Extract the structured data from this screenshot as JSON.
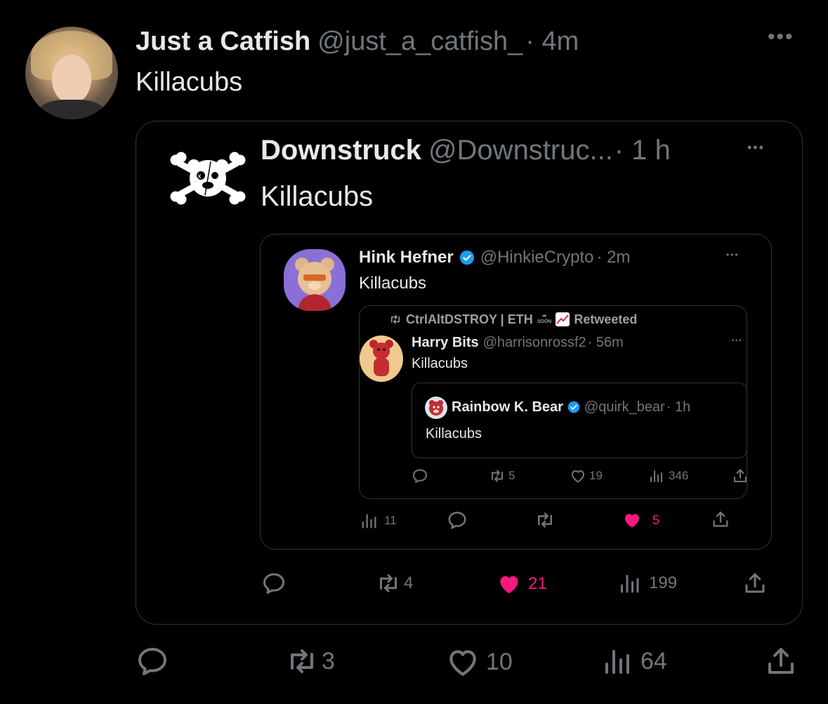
{
  "colors": {
    "background": "#000000",
    "text": "#e7e9ea",
    "muted": "#71767b",
    "like": "#f91880",
    "verified": "#1d9bf0",
    "border": "#2f3336"
  },
  "tweet": {
    "name": "Just a Catfish",
    "handle": "@just_a_catfish_",
    "time": "· 4m",
    "text": "Killacubs",
    "actions": {
      "replies": "",
      "retweets": "3",
      "likes": "10",
      "views": "64"
    }
  },
  "quote1": {
    "name": "Downstruck",
    "handle": "@Downstruc...",
    "time": "· 1 h",
    "text": "Killacubs",
    "actions": {
      "replies": "",
      "retweets": "4",
      "likes": "21",
      "views": "199"
    }
  },
  "quote2": {
    "name": "Hink Hefner",
    "handle": "@HinkieCrypto",
    "time": "· 2m",
    "text": "Killacubs",
    "actions": {
      "views": "11",
      "replies": "",
      "retweets": "",
      "likes": "5"
    }
  },
  "quote3": {
    "retweeted_by": "CtrlAltDSTROY | ETH",
    "retweeted_suffix": "Retweeted",
    "soon_badge": "SOON",
    "name": "Harry Bits",
    "handle": "@harrisonrossf2",
    "time": "· 56m",
    "text": "Killacubs",
    "actions": {
      "replies": "",
      "retweets": "5",
      "likes": "19",
      "views": "346"
    }
  },
  "quote4": {
    "name": "Rainbow K. Bear",
    "handle": "@quirk_bear",
    "time": "· 1h",
    "text": "Killacubs"
  },
  "icons": {
    "more": "more-dots-icon",
    "reply": "reply-bubble-icon",
    "retweet": "retweet-arrows-icon",
    "like": "heart-icon",
    "views": "views-bars-icon",
    "share": "share-upload-icon",
    "verified": "verified-badge-icon"
  }
}
